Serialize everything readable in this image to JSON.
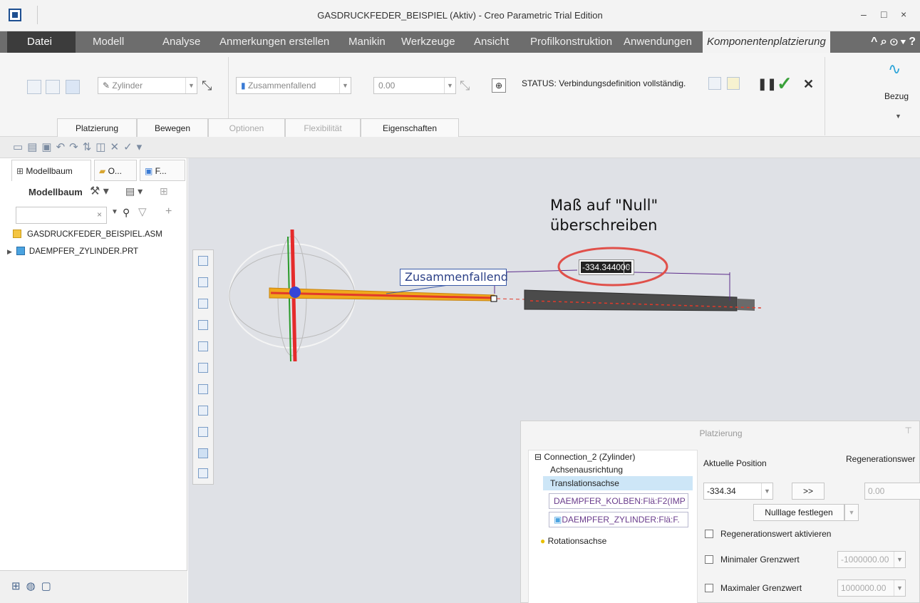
{
  "window": {
    "title": "GASDRUCKFEDER_BEISPIEL (Aktiv) - Creo Parametric Trial Edition",
    "min": "–",
    "max": "□",
    "close": "×"
  },
  "menu": {
    "tabs": [
      "Datei",
      "Modell",
      "Analyse",
      "Anmerkungen erstellen",
      "Manikin",
      "Werkzeuge",
      "Ansicht",
      "Profilkonstruktion",
      "Anwendungen",
      "Komponentenplatzierung"
    ],
    "right_icons": "^ ⌕ ⊙ ▾ ?"
  },
  "ribbon": {
    "constraint_type": "Zylinder",
    "constraint_mode": "Zusammenfallend",
    "offset_value": "0.00",
    "status": "STATUS: Verbindungsdefinition vollständig.",
    "bezug_label": "Bezug",
    "subtabs": [
      "Platzierung",
      "Bewegen",
      "Optionen",
      "Flexibilität",
      "Eigenschaften"
    ]
  },
  "left_panel": {
    "tabs": [
      "Modellbaum",
      "O...",
      "F..."
    ],
    "title": "Modellbaum",
    "search_placeholder": "",
    "tree": [
      "GASDRUCKFEDER_BEISPIEL.ASM",
      "DAEMPFER_ZYLINDER.PRT"
    ]
  },
  "viewport": {
    "annotation_line1": "Maß auf \"Null\"",
    "annotation_line2": "überschreiben",
    "dimension_value": "-334.344000",
    "callout_label": "Zusammenfallend"
  },
  "dialog": {
    "title": "Platzierung",
    "connection": "Connection_2 (Zylinder)",
    "axis_alignment": "Achsenausrichtung",
    "translation_axis": "Translationsachse",
    "ref1": "DAEMPFER_KOLBEN:Flä:F2(IMP",
    "ref2": "DAEMPFER_ZYLINDER:Flä:F.",
    "rotation_axis": "Rotationsachse",
    "current_position_label": "Aktuelle Position",
    "current_position_value": "-334.34",
    "regen_label": "Regenerationswer",
    "regen_value": "0.00",
    "copy_btn": ">>",
    "zero_btn": "Nulllage festlegen",
    "enable_regen": "Regenerationswert aktivieren",
    "min_label": "Minimaler Grenzwert",
    "min_value": "-1000000.00",
    "max_label": "Maximaler Grenzwert",
    "max_value": "1000000.00"
  }
}
